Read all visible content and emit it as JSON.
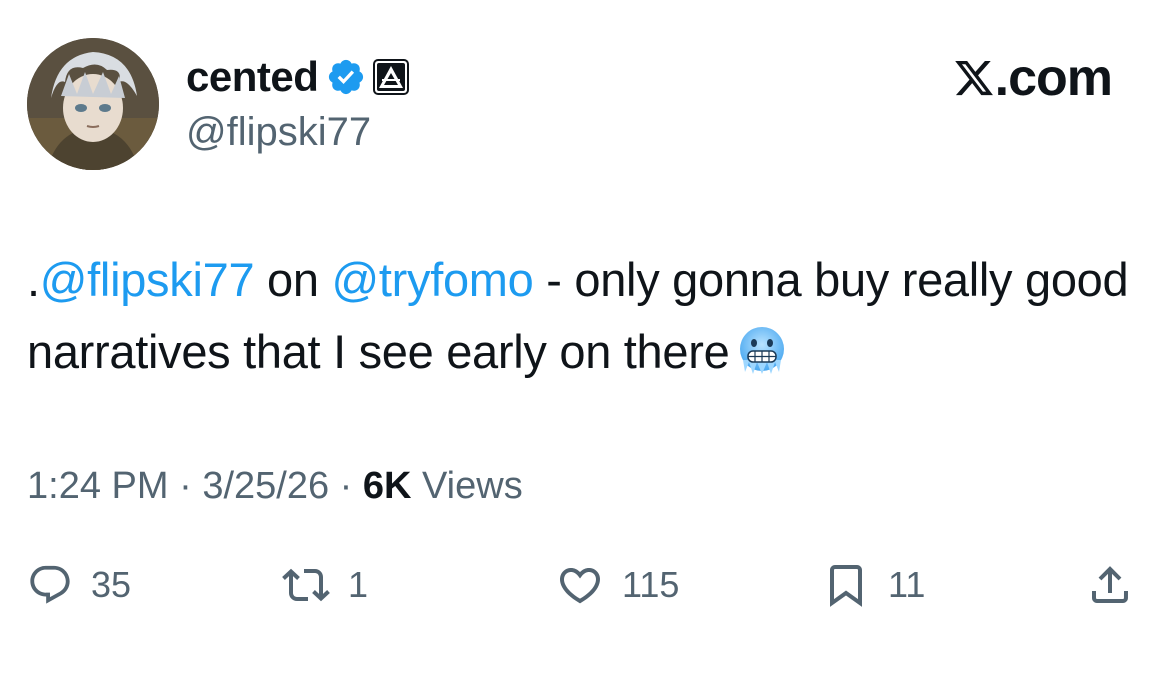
{
  "author": {
    "display_name": "cented",
    "handle": "@flipski77",
    "verified_icon": "verified-badge-icon",
    "affiliation_icon": "affiliate-badge-icon"
  },
  "site": {
    "label": ".com",
    "logo_icon": "x-logo-icon"
  },
  "tweet": {
    "prefix": ".",
    "mention_1": "@flipski77",
    "text_1": " on ",
    "mention_2": "@tryfomo",
    "text_2": " - only gonna buy really good narratives that I see early on there",
    "emoji": "cold-face-emoji"
  },
  "meta": {
    "time": "1:24 PM",
    "sep1": " · ",
    "date": "3/25/26",
    "sep2": " · ",
    "views_count": "6K",
    "views_label": " Views"
  },
  "actions": {
    "replies": "35",
    "reposts": "1",
    "likes": "115",
    "bookmarks": "11"
  },
  "colors": {
    "link": "#1d9bf0",
    "secondary": "#536471",
    "primary": "#0f1419",
    "verified": "#1d9bf0"
  }
}
